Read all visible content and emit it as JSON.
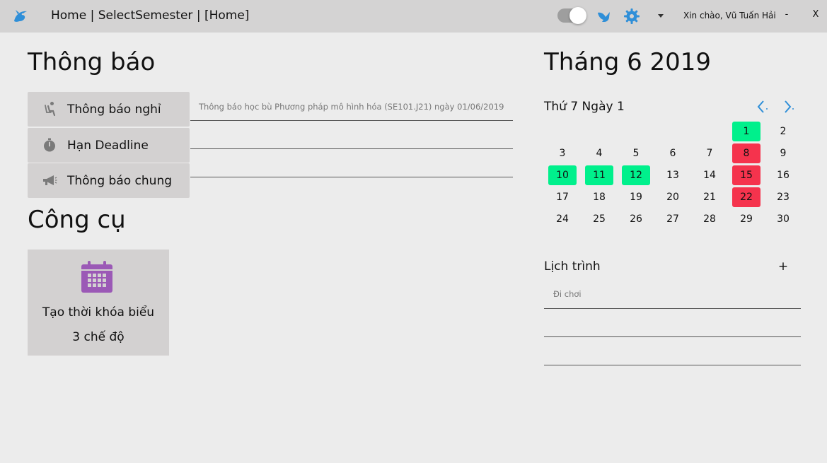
{
  "titlebar": {
    "title": "Home | SelectSemester | [Home]",
    "greeting": "Xin chào, Vũ Tuấn Hải",
    "minimize_label": "-",
    "close_label": "X",
    "toggle_on": true
  },
  "notifications": {
    "title": "Thông báo",
    "items": [
      {
        "label": "Thông báo nghỉ",
        "icon": "chair-person-icon"
      },
      {
        "label": "Hạn Deadline",
        "icon": "stopwatch-icon"
      },
      {
        "label": "Thông báo chung",
        "icon": "megaphone-icon"
      }
    ],
    "entries": [
      "Thông báo học bù Phương pháp mô hình hóa (SE101.J21) ngày 01/06/2019"
    ]
  },
  "tools": {
    "title": "Công cụ",
    "card": {
      "line1": "Tạo thời khóa biểu",
      "line2": "3 chế độ",
      "icon": "calendar-icon"
    }
  },
  "calendar": {
    "month_title": "Tháng 6 2019",
    "selected_label": "Thứ 7 Ngày 1",
    "first_weekday_index": 5,
    "days_in_month": 30,
    "highlight_green": [
      1,
      10,
      11,
      12
    ],
    "highlight_red": [
      8,
      15,
      22
    ],
    "colors": {
      "green": "#00f08c",
      "red": "#f5334d",
      "accent": "#2f8fd8"
    }
  },
  "schedule": {
    "title": "Lịch trình",
    "add_label": "+",
    "entries": [
      "Đi chơi"
    ]
  }
}
